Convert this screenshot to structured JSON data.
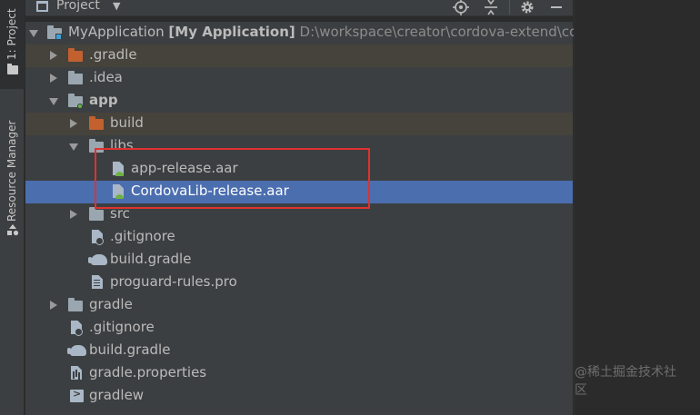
{
  "side_strip": {
    "project_tab": "1: Project",
    "resource_tab": "Resource Manager"
  },
  "header": {
    "title": "Project",
    "icons": [
      "locate-icon",
      "collapse-all-icon",
      "settings-gear-icon",
      "hide-icon"
    ]
  },
  "tree": {
    "root": {
      "name": "MyApplication",
      "module": "[My Application]",
      "path": "D:\\workspace\\creator\\cordova-extend\\cor"
    },
    "rows": [
      {
        "label": ".gradle"
      },
      {
        "label": ".idea"
      },
      {
        "label": "app"
      },
      {
        "label": "build"
      },
      {
        "label": "libs"
      },
      {
        "label": "app-release.aar"
      },
      {
        "label": "CordovaLib-release.aar"
      },
      {
        "label": "src"
      },
      {
        "label": ".gitignore"
      },
      {
        "label": "build.gradle"
      },
      {
        "label": "proguard-rules.pro"
      },
      {
        "label": "gradle"
      },
      {
        "label": ".gitignore"
      },
      {
        "label": "build.gradle"
      },
      {
        "label": "gradle.properties"
      },
      {
        "label": "gradlew"
      }
    ],
    "selected": "CordovaLib-release.aar"
  },
  "watermark": "@稀土掘金技术社区",
  "colors": {
    "selection": "#4b6eaf",
    "annotation": "#e0322f",
    "excluded_folder": "#c2602f"
  }
}
